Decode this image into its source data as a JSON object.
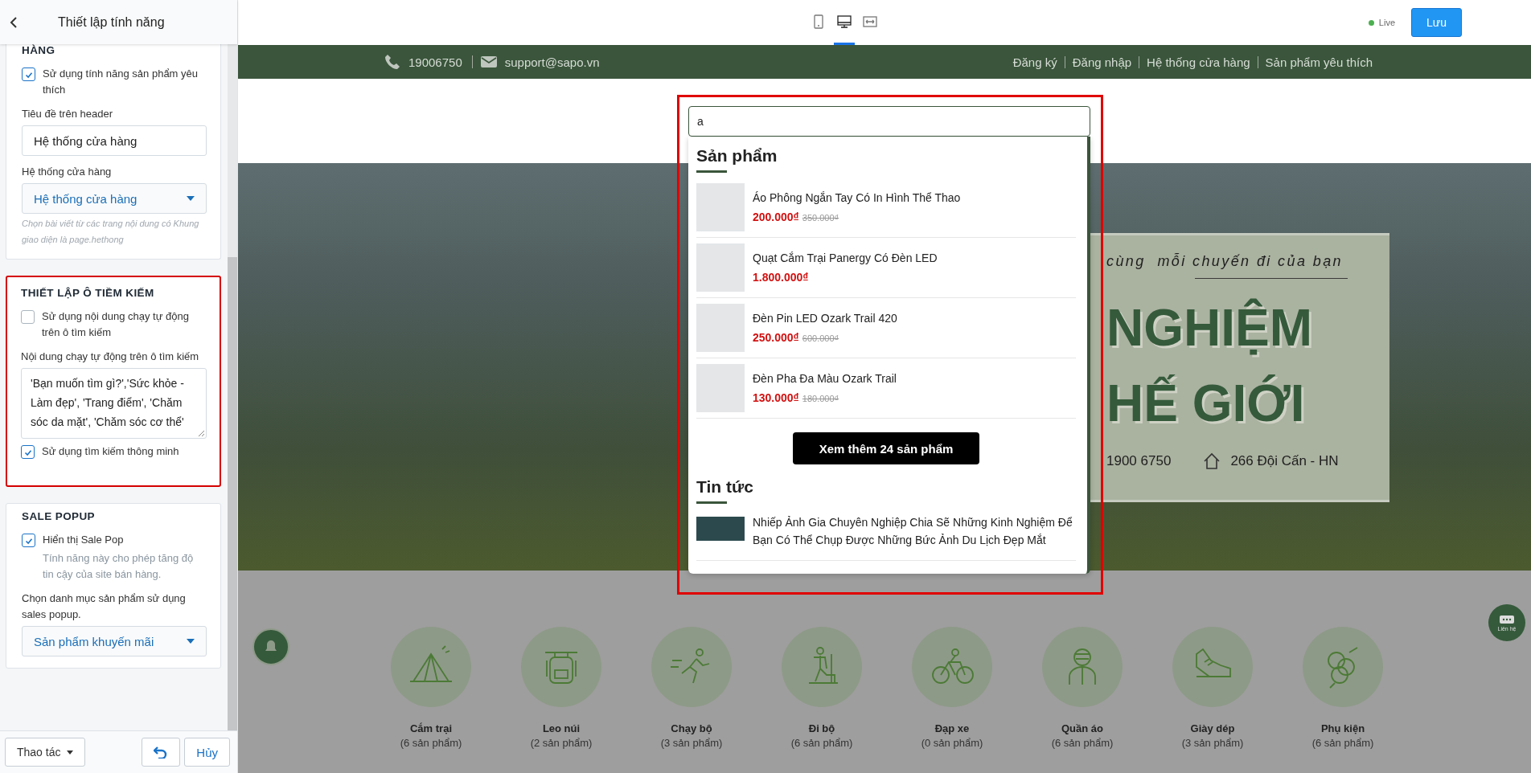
{
  "sidebar": {
    "title": "Thiết lập tính năng",
    "sections": [
      {
        "title": "HÀNG",
        "highlighted": false,
        "items": [
          {
            "kind": "checkbox",
            "label": "Sử dụng tính năng sản phẩm yêu thích",
            "checked": true
          },
          {
            "kind": "text",
            "label": "Tiêu đề trên header",
            "value": "Hệ thống cửa hàng"
          },
          {
            "kind": "select",
            "label": "Hệ thống cửa hàng",
            "value": "Hệ thống cửa hàng",
            "hint": "Chọn bài viết từ các trang nội dung có Khung giao diện là page.hethong"
          }
        ]
      },
      {
        "title": "THIẾT LẬP Ô TIỀM KIẾM",
        "highlighted": true,
        "items": [
          {
            "kind": "checkbox",
            "label": "Sử dụng nội dung chạy tự động trên ô tìm kiếm",
            "checked": false
          },
          {
            "kind": "textarea",
            "label": "Nội dung chạy tự động trên ô tìm kiếm",
            "value": "'Bạn muốn tìm gì?','Sức khỏe - Làm đẹp', 'Trang điểm', 'Chăm sóc da mặt', 'Chăm sóc cơ thể'"
          },
          {
            "kind": "checkbox",
            "label": "Sử dụng tìm kiếm thông minh",
            "checked": true
          }
        ]
      },
      {
        "title": "SALE POPUP",
        "highlighted": false,
        "items": [
          {
            "kind": "checkbox",
            "label": "Hiển thị Sale Pop",
            "checked": true,
            "description": "Tính năng này cho phép tăng độ tin cậy của site bán hàng."
          },
          {
            "kind": "select",
            "label": "Chọn danh mục sản phẩm sử dụng sales popup.",
            "value": "Sản phẩm khuyến mãi"
          }
        ]
      }
    ]
  },
  "footer": {
    "actions": "Thao tác",
    "cancel": "Hủy"
  },
  "toolbar": {
    "devices": [
      {
        "selected": false
      },
      {
        "selected": true
      },
      {
        "selected": false
      }
    ],
    "live": true,
    "status": "Live",
    "save": "Lưu"
  },
  "store": {
    "topbar": {
      "phone": "19006750",
      "email": "support@sapo.vn",
      "links": [
        "Đăng ký",
        "Đăng nhập",
        "Hệ thống cửa hàng",
        "Sản phẩm yêu thích"
      ]
    },
    "search": {
      "value": "a",
      "highlighted": true,
      "products_title": "Sản phẩm",
      "products": [
        {
          "name": "Áo Phông Ngắn Tay Có In Hình Thể Thao",
          "price": "200.000₫",
          "old_price": "350.000₫"
        },
        {
          "name": "Quạt Cắm Trại Panergy Có Đèn LED",
          "price": "1.800.000₫"
        },
        {
          "name": "Đèn Pin LED Ozark Trail 420",
          "price": "250.000₫",
          "old_price": "600.000₫"
        },
        {
          "name": "Đèn Pha Đa Màu Ozark Trail",
          "price": "130.000₫",
          "old_price": "180.000₫"
        }
      ],
      "more_button": "Xem thêm 24 sản phẩm",
      "news_title": "Tin tức",
      "news": [
        {
          "title": "Nhiếp Ảnh Gia Chuyên Nghiệp Chia Sẽ Những Kinh Nghiệm Để Bạn Có Thể Chụp Được Những Bức Ảnh Du Lịch Đẹp Mắt"
        }
      ]
    },
    "hero": {
      "tagline": "cùng  mỗi chuyến đi của bạn",
      "headline": [
        "NGHIỆM",
        "HẾ GIỚI"
      ],
      "phone": "1900 6750",
      "address": "266 Đội Cấn - HN"
    },
    "categories": [
      {
        "name": "Cắm trại",
        "count": "(6 sản phẩm)"
      },
      {
        "name": "Leo núi",
        "count": "(2 sản phẩm)"
      },
      {
        "name": "Chạy bộ",
        "count": "(3 sản phẩm)"
      },
      {
        "name": "Đi bộ",
        "count": "(6 sản phẩm)"
      },
      {
        "name": "Đạp xe",
        "count": "(0 sản phẩm)"
      },
      {
        "name": "Quần áo",
        "count": "(6 sản phẩm)"
      },
      {
        "name": "Giày dép",
        "count": "(3 sản phẩm)"
      },
      {
        "name": "Phụ kiện",
        "count": "(6 sản phẩm)"
      }
    ],
    "chat_label": "Liên hệ"
  }
}
